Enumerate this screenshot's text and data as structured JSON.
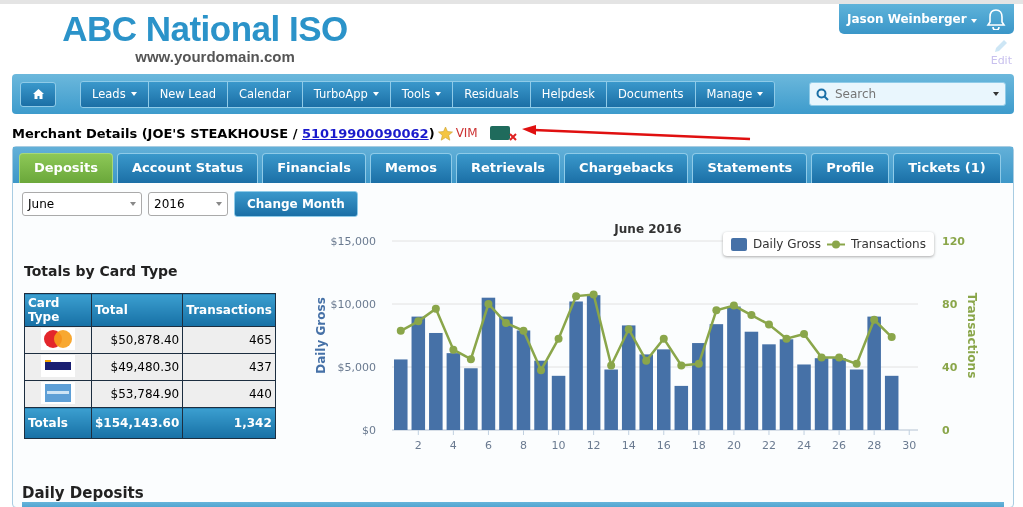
{
  "header": {
    "logo": "ABC National ISO",
    "domain": "www.yourdomain.com",
    "user": "Jason Weinberger",
    "edit": "Edit"
  },
  "nav": {
    "items": [
      {
        "label": "Leads",
        "dropdown": true
      },
      {
        "label": "New Lead",
        "dropdown": false
      },
      {
        "label": "Calendar",
        "dropdown": false
      },
      {
        "label": "TurboApp",
        "dropdown": true
      },
      {
        "label": "Tools",
        "dropdown": true
      },
      {
        "label": "Residuals",
        "dropdown": false
      },
      {
        "label": "Helpdesk",
        "dropdown": false
      },
      {
        "label": "Documents",
        "dropdown": false
      },
      {
        "label": "Manage",
        "dropdown": true
      }
    ],
    "search": {
      "placeholder": "Search"
    }
  },
  "merchant": {
    "prefix": "Merchant Details (JOE'S STEAKHOUSE / ",
    "mid": "51019900090062",
    "suffix": ")",
    "badge": "VIM"
  },
  "tabs": [
    {
      "label": "Deposits",
      "selected": true
    },
    {
      "label": "Account Status",
      "selected": false
    },
    {
      "label": "Financials",
      "selected": false
    },
    {
      "label": "Memos",
      "selected": false
    },
    {
      "label": "Retrievals",
      "selected": false
    },
    {
      "label": "Chargebacks",
      "selected": false
    },
    {
      "label": "Statements",
      "selected": false
    },
    {
      "label": "Profile",
      "selected": false
    },
    {
      "label": "Tickets (1)",
      "selected": false
    }
  ],
  "filters": {
    "month": "June",
    "year": "2016",
    "button": "Change Month"
  },
  "totals": {
    "title": "Totals by Card Type",
    "columns": [
      "Card Type",
      "Total",
      "Transactions"
    ],
    "rows": [
      {
        "kind": "mastercard",
        "total": "$50,878.40",
        "transactions": "465"
      },
      {
        "kind": "visa",
        "total": "$49,480.30",
        "transactions": "437"
      },
      {
        "kind": "amex",
        "total": "$53,784.90",
        "transactions": "440"
      }
    ],
    "footer": [
      "Totals",
      "$154,143.60",
      "1,342"
    ]
  },
  "chart": {
    "chart_data": {
      "type": "bar",
      "title": "June 2016",
      "ylabel": "Daily Gross",
      "y2label": "Transactions",
      "x": [
        1,
        2,
        3,
        4,
        5,
        6,
        7,
        8,
        9,
        10,
        11,
        12,
        13,
        14,
        15,
        16,
        17,
        18,
        19,
        20,
        21,
        22,
        23,
        24,
        25,
        26,
        27,
        28,
        29
      ],
      "xlim": [
        0.5,
        30.5
      ],
      "xticks": [
        2,
        4,
        6,
        8,
        10,
        12,
        14,
        16,
        18,
        20,
        22,
        24,
        26,
        28,
        30
      ],
      "legend": true,
      "ylim": [
        0,
        15000
      ],
      "yticks": [
        {
          "value": 0,
          "label": "$0"
        },
        {
          "value": 5000,
          "label": "$5,000"
        },
        {
          "value": 10000,
          "label": "$10,000"
        },
        {
          "value": 15000,
          "label": "$15,000"
        }
      ],
      "y2lim": [
        0,
        120
      ],
      "y2ticks": [
        0,
        40,
        80,
        120
      ],
      "series": [
        {
          "name": "Daily Gross",
          "color": "#4671a7",
          "values": [
            5600,
            9000,
            7700,
            6100,
            4900,
            10500,
            9000,
            7900,
            5500,
            4300,
            10200,
            10700,
            4800,
            8300,
            6000,
            6400,
            3500,
            6900,
            8400,
            9800,
            7800,
            6800,
            7200,
            5200,
            5700,
            5700,
            4800,
            9000,
            4300
          ]
        },
        {
          "name": "Transactions",
          "type": "line",
          "axis": "y2",
          "marker": "circle",
          "color": "#8aa64a",
          "values": [
            63,
            69,
            77,
            51,
            45,
            80,
            68,
            63,
            38,
            58,
            85,
            86,
            41,
            64,
            44,
            58,
            41,
            42,
            76,
            79,
            73,
            67,
            58,
            61,
            46,
            46,
            42,
            70,
            59
          ]
        }
      ]
    }
  },
  "daily_deposits": {
    "title": "Daily Deposits"
  }
}
